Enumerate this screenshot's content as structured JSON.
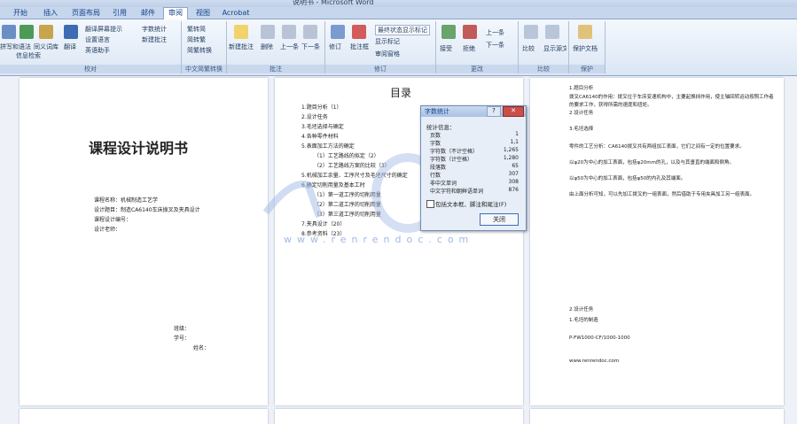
{
  "tabs": [
    "开始",
    "插入",
    "页面布局",
    "引用",
    "邮件",
    "审阅",
    "视图",
    "Acrobat"
  ],
  "ribbon": {
    "groups": [
      {
        "label": "校对",
        "buttons": [
          "拼写和语法",
          "信息检索",
          "同义词库",
          "翻译",
          "翻译屏幕提示",
          "设置语言",
          "字数统计",
          "英语助手",
          "新建批注"
        ]
      },
      {
        "label": "中文简繁转换",
        "buttons": [
          "繁转简",
          "简转繁",
          "简繁转换"
        ]
      },
      {
        "label": "批注",
        "buttons": [
          "新建批注",
          "删除",
          "上一条",
          "下一条"
        ]
      },
      {
        "label": "修订",
        "buttons": [
          "修订",
          "批注框",
          "最终状态显示标记",
          "显示标记",
          "审阅窗格"
        ]
      },
      {
        "label": "更改",
        "buttons": [
          "接受",
          "拒绝",
          "上一条",
          "下一条"
        ]
      },
      {
        "label": "比较",
        "buttons": [
          "比较",
          "显示源文档"
        ]
      },
      {
        "label": "保护",
        "buttons": [
          "保护文档"
        ]
      }
    ]
  },
  "page1": {
    "title": "课程设计说明书",
    "fields": [
      "课程名称：机械制造工艺学",
      "设计题目：制造CA6140车床拨叉及夹具设计",
      "课程设计编号：",
      "设计老师："
    ],
    "signatures": [
      "班级：",
      "学号：",
      "姓名："
    ]
  },
  "page2": {
    "heading": "目录",
    "items": [
      "1.题目分析（1）",
      "2.设计任务",
      "3.毛坯选择与确定",
      "4.各种零件材料",
      "5.表面加工方法的确定",
      "（1）工艺路线的拟定（2）",
      "（2）工艺路线方案的比较（3）",
      "5.机械加工余量、工序尺寸及毛坯尺寸的确定",
      "6.确定切削用量及基本工时",
      "（1）第一道工序的切削用量",
      "（2）第二道工序的切削用量",
      "（3）第三道工序的切削用量",
      "7.夹具设计（20）",
      "8.参考资料（23）"
    ]
  },
  "page3": {
    "lines": [
      "1.题目分析",
      "拨叉CA6140的作用：拨叉位于车床变速机构中，主要起换挡作用，使主轴回转运动按照工作者的要求工作，获得所需的速度和扭矩。",
      "2.设计任务",
      "3.毛坯选择",
      "零件的工艺分析：CA6140拨叉共有两组加工表面，它们之间有一定的位置要求。",
      "以φ20为中心的加工表面，包括φ20mm的孔，以及与其垂直的端面和倒角。",
      "以φ50为中心的加工表面，包括φ50的内孔及其端面。",
      "由上面分析可知，可以先加工拨叉的一组表面，然后借助于专用夹具加工另一组表面。",
      "2.设计任务",
      "1.毛坯的制造",
      "P-FW1000-CF/1000-1000",
      "www.renrendoc.com"
    ]
  },
  "dialog": {
    "title": "字数统计",
    "section": "统计信息：",
    "rows": [
      {
        "label": "页数",
        "value": "1"
      },
      {
        "label": "字数",
        "value": "1,1"
      },
      {
        "label": "字符数（不计空格）",
        "value": "1,265"
      },
      {
        "label": "字符数（计空格）",
        "value": "1,280"
      },
      {
        "label": "段落数",
        "value": "65"
      },
      {
        "label": "行数",
        "value": "307"
      },
      {
        "label": "非中文单词",
        "value": "308"
      },
      {
        "label": "中文字符和朝鲜语单词",
        "value": "876"
      }
    ],
    "checkbox": "包括文本框、脚注和尾注(F)",
    "close": "关闭"
  },
  "watermark": "www.renrendoc.com",
  "colors": {
    "ribbon_top": "#f4f8fd",
    "tab_text": "#15428b",
    "watermark": "#9fb9e6"
  }
}
